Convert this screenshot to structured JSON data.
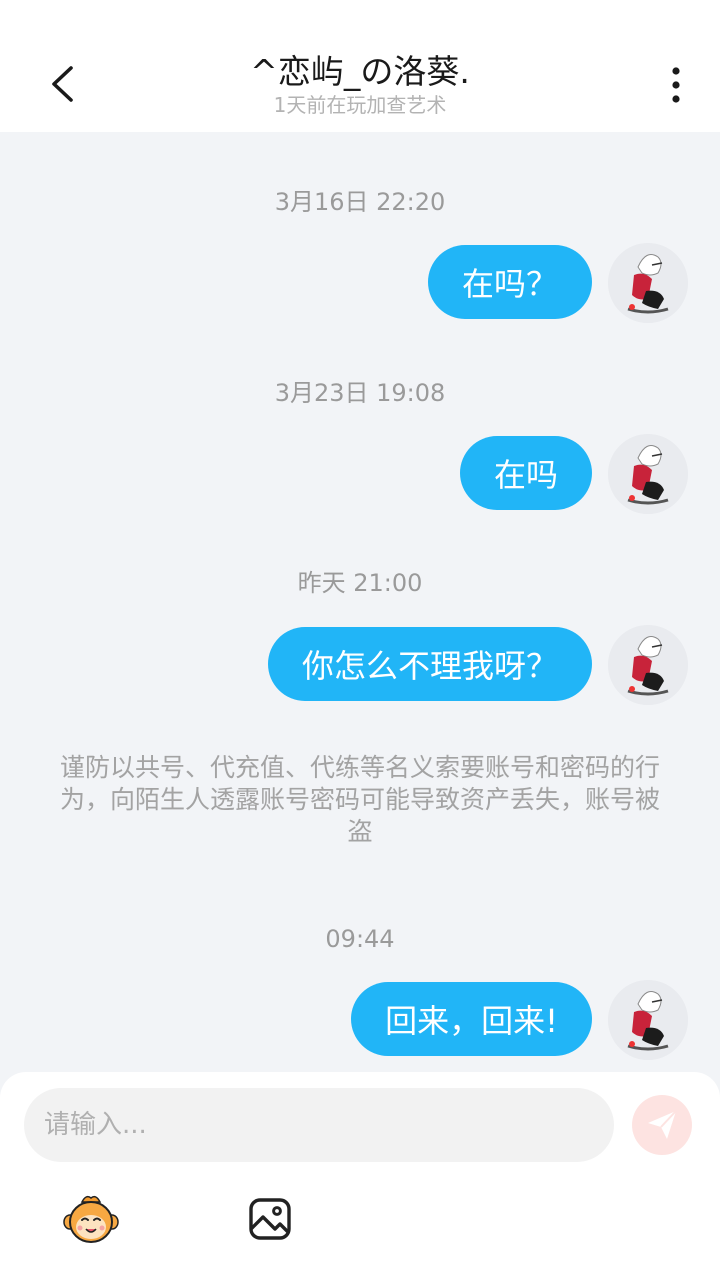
{
  "header": {
    "title": "^恋屿_の洛葵.",
    "subtitle": "1天前在玩加查艺术",
    "back_icon": "chevron-left-icon",
    "more_icon": "more-vertical-icon"
  },
  "messages": [
    {
      "time": "3月16日 22:20",
      "text": "在吗？"
    },
    {
      "time": "3月23日 19:08",
      "text": "在吗"
    },
    {
      "time": "昨天 21:00",
      "text": "你怎么不理我呀？"
    },
    {
      "time": "09:44",
      "text": "回来，回来!"
    }
  ],
  "notice": "谨防以共号、代充值、代练等名义索要账号和密码的行为，向陌生人透露账号密码可能导致资产丢失，账号被盗",
  "composer": {
    "placeholder": "请输入...",
    "send_icon": "send-icon",
    "emoji_icon": "emoji-icon",
    "image_icon": "image-icon"
  },
  "colors": {
    "bubble": "#21b5f7",
    "background": "#f2f4f7",
    "send_disabled": "#fde3e1"
  }
}
